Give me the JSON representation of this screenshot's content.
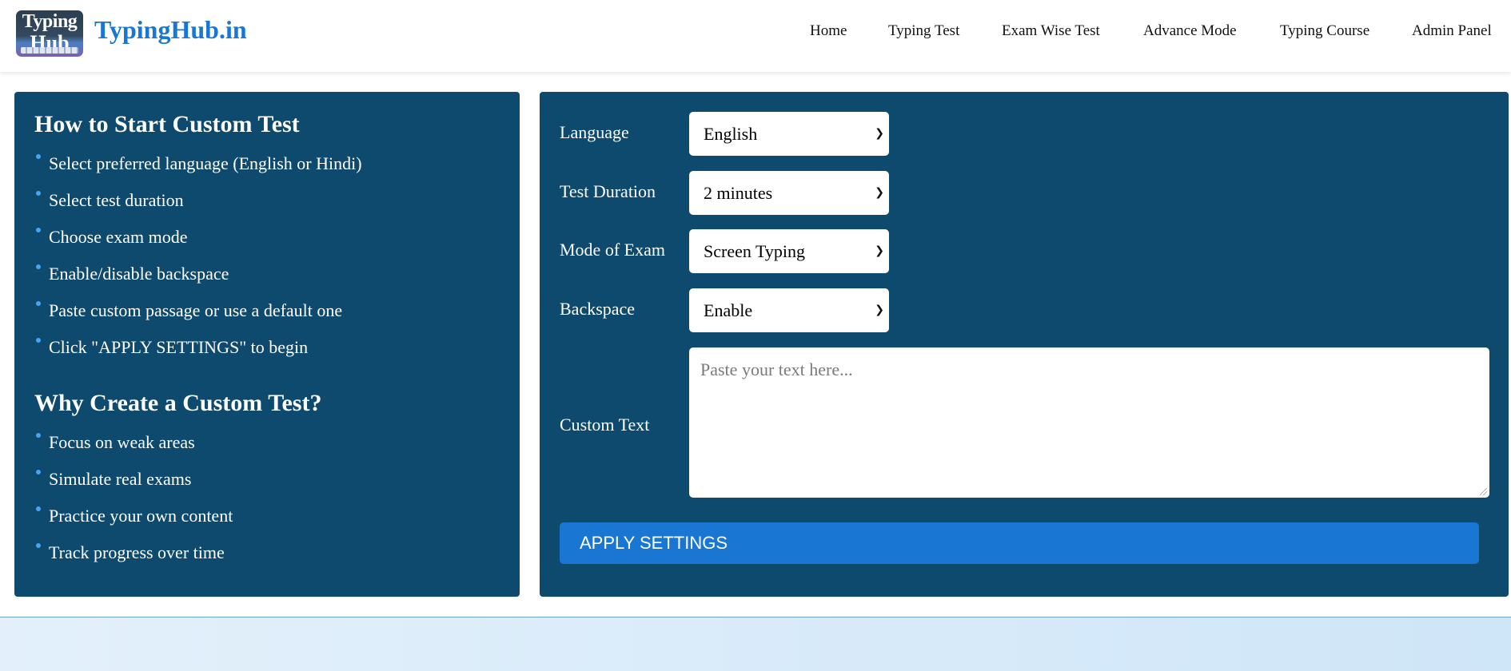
{
  "header": {
    "logo": {
      "line1": "Typing",
      "line2": "Hub"
    },
    "brand": "TypingHub.in",
    "nav": [
      "Home",
      "Typing Test",
      "Exam Wise Test",
      "Advance Mode",
      "Typing Course",
      "Admin Panel"
    ]
  },
  "instructions": {
    "heading": "How to Start Custom Test",
    "steps": [
      "Select preferred language (English or Hindi)",
      "Select test duration",
      "Choose exam mode",
      "Enable/disable backspace",
      "Paste custom passage or use a default one",
      "Click \"APPLY SETTINGS\" to begin"
    ],
    "why_heading": "Why Create a Custom Test?",
    "reasons": [
      "Focus on weak areas",
      "Simulate real exams",
      "Practice your own content",
      "Track progress over time"
    ]
  },
  "settings": {
    "language": {
      "label": "Language",
      "value": "English"
    },
    "duration": {
      "label": "Test Duration",
      "value": "2 minutes"
    },
    "mode": {
      "label": "Mode of Exam",
      "value": "Screen Typing"
    },
    "backspace": {
      "label": "Backspace",
      "value": "Enable"
    },
    "custom_text": {
      "label": "Custom Text",
      "value": "",
      "placeholder": "Paste your text here..."
    },
    "apply_label": "APPLY SETTINGS"
  },
  "colors": {
    "panel": "#0d4a6e",
    "accent": "#1976d2",
    "bullet": "#42a5f5"
  }
}
